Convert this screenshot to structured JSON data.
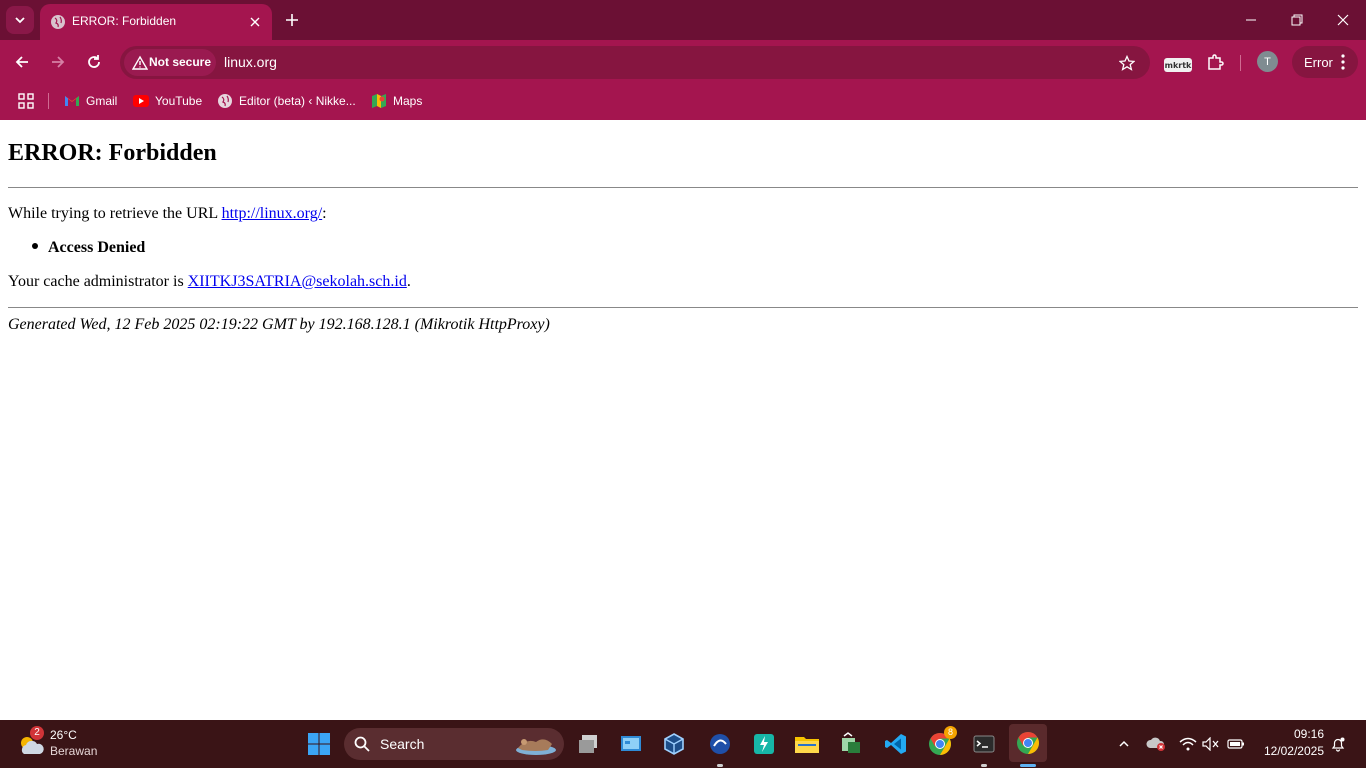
{
  "browser": {
    "tab": {
      "title": "ERROR: Forbidden"
    },
    "omnibox": {
      "security_label": "Not secure",
      "url": "linux.org"
    },
    "profile_initial": "T",
    "status_button_label": "Error",
    "extension_label": "mkrtk"
  },
  "bookmarks": [
    {
      "label": "Gmail",
      "icon": "gmail-icon"
    },
    {
      "label": "YouTube",
      "icon": "youtube-icon"
    },
    {
      "label": "Editor (beta) ‹ Nikke...",
      "icon": "globe-icon"
    },
    {
      "label": "Maps",
      "icon": "maps-icon"
    }
  ],
  "page": {
    "heading": "ERROR: Forbidden",
    "retrieve_prefix": "While trying to retrieve the URL ",
    "retrieve_url": "http://linux.org/",
    "retrieve_suffix": ":",
    "list_item": "Access Denied",
    "admin_prefix": "Your cache administrator is ",
    "admin_email": "XIITKJ3SATRIA@sekolah.sch.id",
    "admin_suffix": ".",
    "footer": "Generated Wed, 12 Feb 2025 02:19:22 GMT by 192.168.128.1 (Mikrotik HttpProxy)"
  },
  "taskbar": {
    "weather": {
      "temp": "26°C",
      "condition": "Berawan",
      "badge": "2"
    },
    "search_label": "Search",
    "chrome_badge": "8",
    "clock": {
      "time": "09:16",
      "date": "12/02/2025"
    }
  },
  "colors": {
    "titlebar": "#6b1034",
    "toolbar": "#a4154f",
    "link": "#0000ee",
    "taskbar": "#3a1416"
  }
}
